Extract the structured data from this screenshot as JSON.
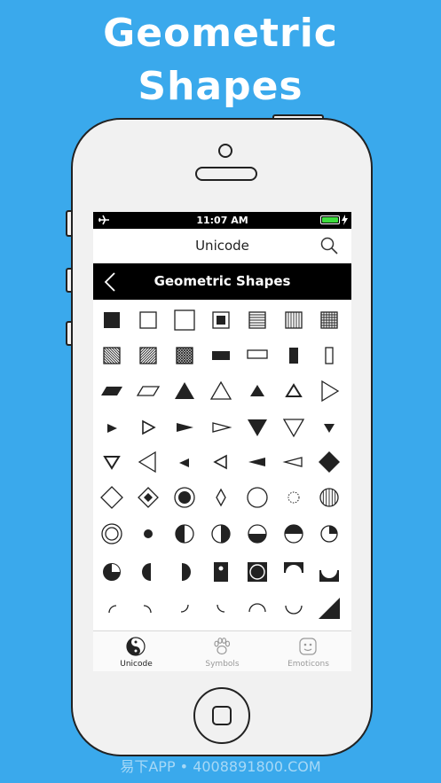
{
  "promo": {
    "title_line1": "Geometric",
    "title_line2": "Shapes"
  },
  "status_bar": {
    "time": "11:07 AM",
    "icons": [
      "airplane-icon",
      "battery-icon",
      "charging-bolt-icon"
    ]
  },
  "nav": {
    "title": "Unicode",
    "search_icon": "search-icon"
  },
  "section": {
    "title": "Geometric Shapes",
    "back_icon": "chevron-left-icon"
  },
  "shapes": [
    [
      "black-square",
      "white-square",
      "white-square-large",
      "square-with-square",
      "square-horizontal-fill",
      "square-vertical-fill",
      "square-crosshatch"
    ],
    [
      "square-diagonal-fill",
      "square-diagonal-fill-rev",
      "square-diagonal-crosshatch",
      "black-rect",
      "white-rect",
      "black-vertical-rect",
      "white-vertical-rect"
    ],
    [
      "black-parallelogram",
      "white-parallelogram",
      "black-up-triangle",
      "white-up-triangle",
      "black-up-triangle-small",
      "white-up-triangle-small",
      "white-right-triangle"
    ],
    [
      "black-right-triangle-small",
      "white-right-triangle-small",
      "black-right-pointer",
      "white-right-pointer",
      "black-down-triangle",
      "white-down-triangle",
      "black-down-triangle-small"
    ],
    [
      "white-down-triangle-small",
      "white-left-triangle",
      "black-left-triangle-small",
      "white-left-triangle-small",
      "black-left-pointer",
      "white-left-pointer",
      "black-diamond"
    ],
    [
      "white-diamond",
      "diamond-with-diamond",
      "fisheye",
      "lozenge",
      "white-circle",
      "dotted-circle",
      "circle-vertical-fill"
    ],
    [
      "bullseye",
      "black-circle-small",
      "circle-left-half-black",
      "circle-right-half-black",
      "circle-lower-half-black",
      "circle-upper-half-black",
      "circle-upper-right-quadrant-black"
    ],
    [
      "circle-upper-right-quadrant-white",
      "black-left-half-circle",
      "black-right-half-circle",
      "square-with-circle-hole",
      "square-with-circle",
      "square-upper-half-circle",
      "square-lower-half-circle"
    ],
    [
      "arc-upper-left",
      "arc-upper-right",
      "arc-lower-right",
      "arc-lower-left",
      "upper-half-circle-arc",
      "lower-half-circle-arc",
      "black-lower-right-triangle"
    ]
  ],
  "tabs": [
    {
      "label": "Unicode",
      "icon": "yin-yang-icon",
      "active": true
    },
    {
      "label": "Symbols",
      "icon": "paw-icon",
      "active": false
    },
    {
      "label": "Emoticons",
      "icon": "emoticon-face-icon",
      "active": false
    }
  ],
  "watermark": "易下APP • 4008891800.COM"
}
